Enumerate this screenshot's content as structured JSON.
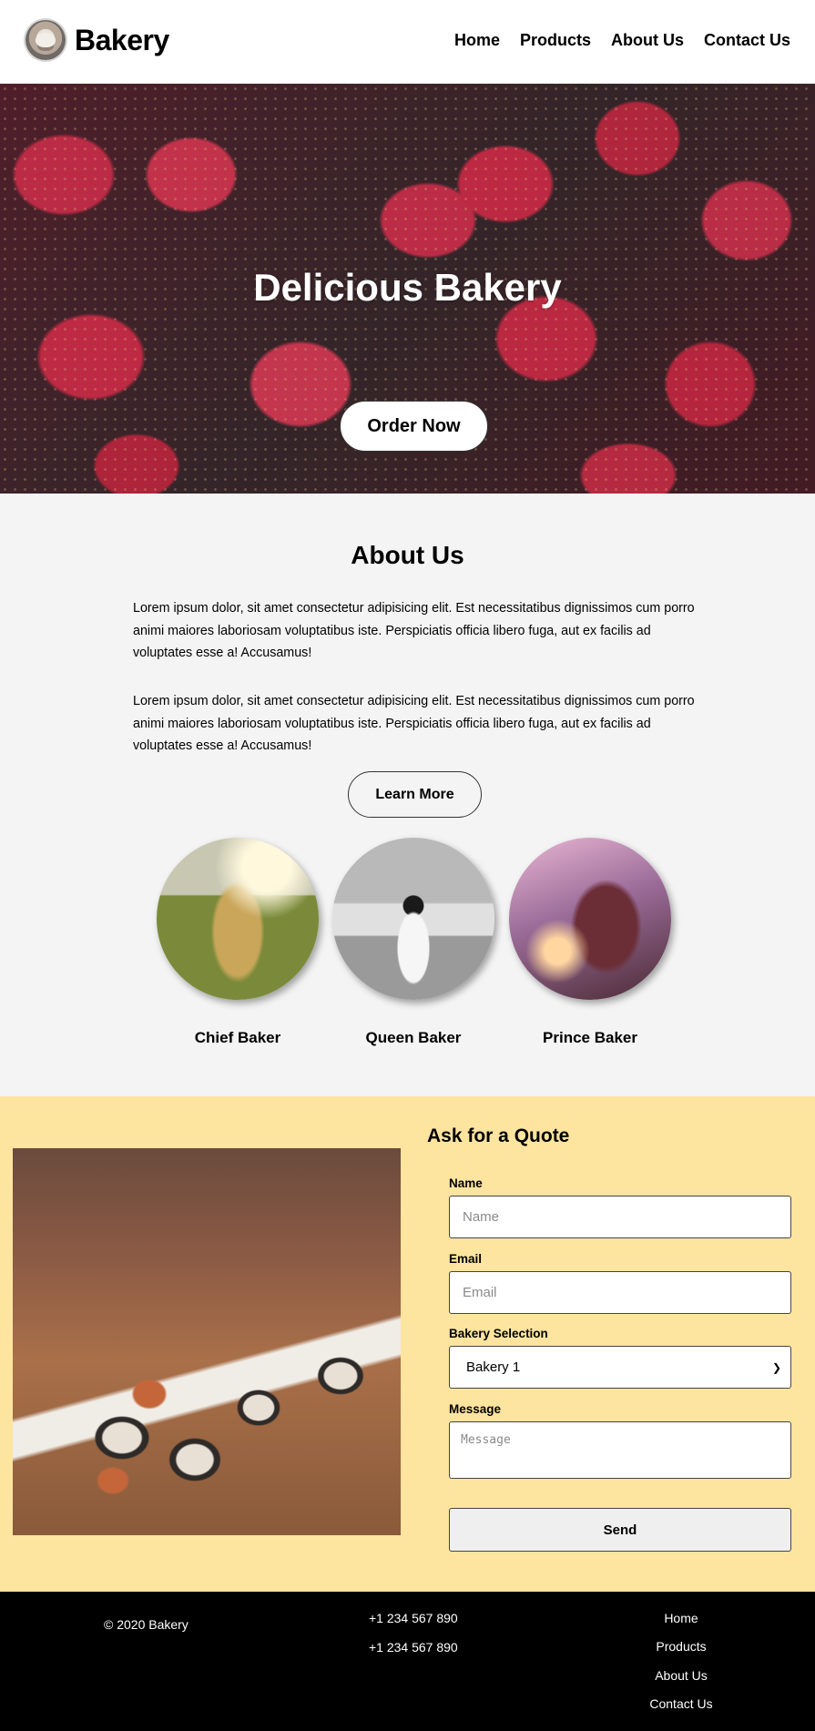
{
  "header": {
    "brand": "Bakery",
    "nav": [
      "Home",
      "Products",
      "About Us",
      "Contact Us"
    ]
  },
  "hero": {
    "title": "Delicious Bakery",
    "cta": "Order Now"
  },
  "about": {
    "title": "About Us",
    "paragraphs": [
      "Lorem ipsum dolor, sit amet consectetur adipisicing elit. Est necessitatibus dignissimos cum porro animi maiores laboriosam voluptatibus iste. Perspiciatis officia libero fuga, aut ex facilis ad voluptates esse a! Accusamus!",
      "Lorem ipsum dolor, sit amet consectetur adipisicing elit. Est necessitatibus dignissimos cum porro animi maiores laboriosam voluptatibus iste. Perspiciatis officia libero fuga, aut ex facilis ad voluptates esse a! Accusamus!"
    ],
    "button": "Learn More",
    "bakers": [
      "Chief Baker",
      "Queen Baker",
      "Prince Baker"
    ]
  },
  "quote": {
    "title": "Ask for a Quote",
    "name_label": "Name",
    "name_placeholder": "Name",
    "email_label": "Email",
    "email_placeholder": "Email",
    "selection_label": "Bakery Selection",
    "selection_value": "Bakery 1",
    "message_label": "Message",
    "message_placeholder": "Message",
    "send": "Send"
  },
  "footer": {
    "copyright": "© 2020 Bakery",
    "phones": [
      "+1 234 567 890",
      "+1 234 567 890"
    ],
    "links": [
      "Home",
      "Products",
      "About Us",
      "Contact Us"
    ]
  },
  "colors": {
    "quote_bg": "#fde49f",
    "about_bg": "#f4f4f4",
    "footer_bg": "#000000"
  }
}
